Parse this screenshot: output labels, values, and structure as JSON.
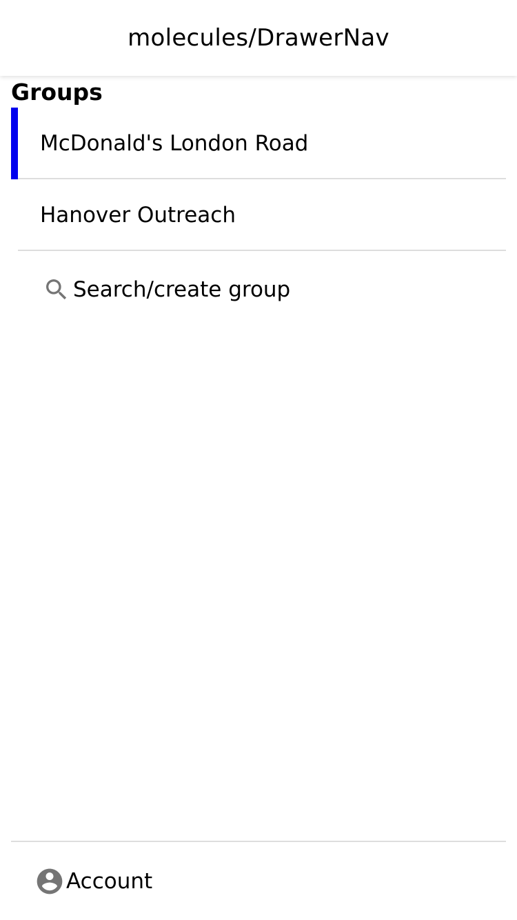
{
  "header": {
    "title": "molecules/DrawerNav"
  },
  "groups": {
    "title": "Groups",
    "items": [
      {
        "label": "McDonald's London Road",
        "active": true
      },
      {
        "label": "Hanover Outreach",
        "active": false
      }
    ],
    "search_label": "Search/create group"
  },
  "account": {
    "label": "Account"
  },
  "colors": {
    "active_indicator": "#0000ee",
    "icon_gray": "#757575",
    "divider": "#dddddd"
  },
  "icons": {
    "search": "search-icon",
    "account": "account-circle-icon"
  }
}
